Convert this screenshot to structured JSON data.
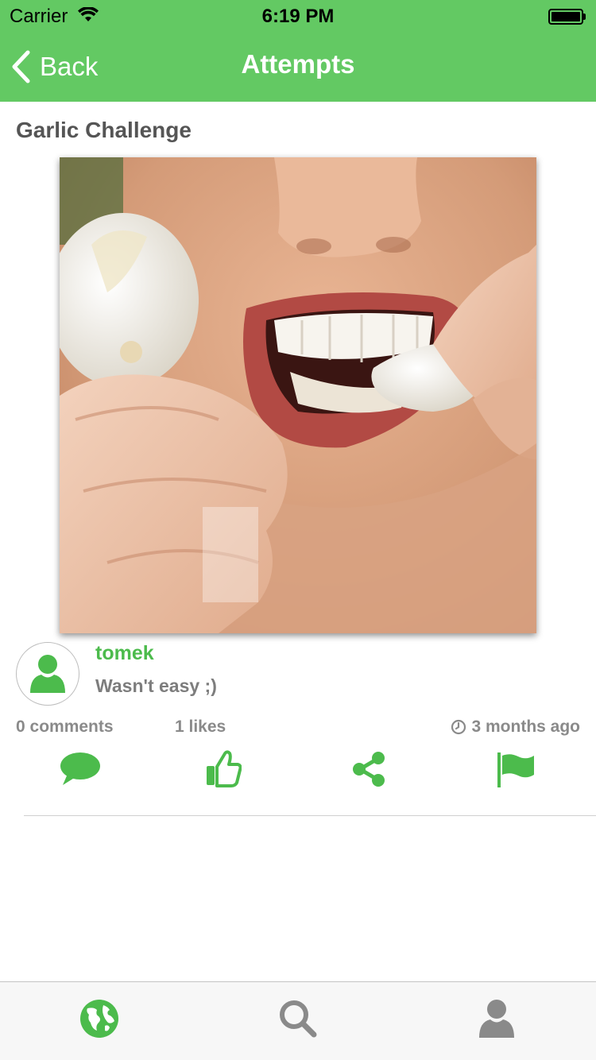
{
  "status_bar": {
    "carrier": "Carrier",
    "time": "6:19 PM"
  },
  "nav": {
    "back_label": "Back",
    "title": "Attempts"
  },
  "challenge": {
    "title": "Garlic Challenge"
  },
  "post": {
    "username": "tomek",
    "caption": "Wasn't easy ;)",
    "comments": "0 comments",
    "likes": "1 likes",
    "time_ago": "3 months ago"
  },
  "actions": [
    {
      "icon": "comment-icon"
    },
    {
      "icon": "thumbs-up-icon"
    },
    {
      "icon": "share-icon"
    },
    {
      "icon": "flag-icon"
    }
  ],
  "tabbar": {
    "tabs": [
      {
        "icon": "globe-icon",
        "active": true
      },
      {
        "icon": "search-icon",
        "active": false
      },
      {
        "icon": "user-icon",
        "active": false
      }
    ]
  },
  "colors": {
    "brand_green": "#63c963",
    "accent_green": "#4cbb4c",
    "inactive_gray": "#8a8a8a"
  }
}
